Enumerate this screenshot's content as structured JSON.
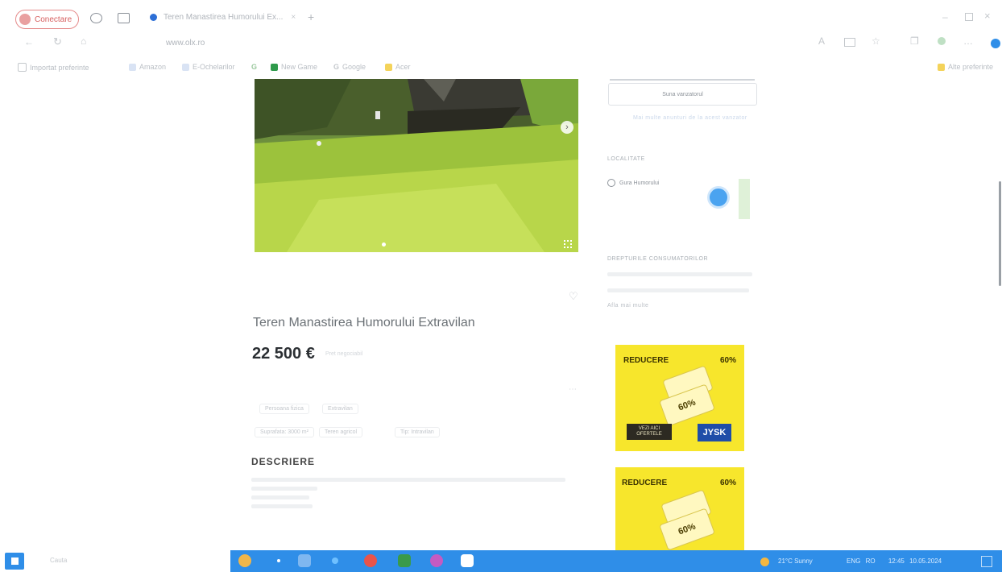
{
  "browser": {
    "signin_label": "Conectare",
    "tab_title": "Teren Manastirea Humorului Ex...",
    "url": "www.olx.ro",
    "bookmarks": [
      "Importat preferinte",
      "Amazon",
      "E-Ochelarilor",
      "New Game",
      "Google",
      "Acer"
    ],
    "other_favorites": "Alte preferinte"
  },
  "listing": {
    "title": "Teren Manastirea Humorului Extravilan",
    "price": "22 500 €",
    "price_note": "Pret negociabil",
    "tags": [
      "Persoana fizica",
      "Extravilan",
      "Suprafata: 3000 m²",
      "Teren agricol",
      "Tip: Intravilan"
    ],
    "description_heading": "DESCRIERE"
  },
  "sidebar": {
    "category_button": "Suna vanzatorul",
    "seller_link": "Mai multe anunturi de la acest vanzator",
    "location_heading": "LOCALITATE",
    "location_value": "Gura Humorului",
    "consumer_heading": "DREPTURILE CONSUMATORILOR",
    "see_more": "Afla mai multe"
  },
  "ads": [
    {
      "label": "REDUCERE",
      "percent": "60%",
      "brand": "JYSK",
      "button": "VEZI AICI OFERTELE"
    },
    {
      "label": "REDUCERE",
      "percent": "60%"
    }
  ],
  "taskbar": {
    "search_placeholder": "Cauta",
    "weather": "21°C  Sunny",
    "lang": "ENG",
    "region": "RO",
    "time": "12:45",
    "date": "10.05.2024"
  },
  "colors": {
    "taskbar_blue": "#2f8ee8",
    "ad_yellow": "#f7e62c",
    "price_text": "#2b2f33"
  },
  "icons": [
    "profile-icon",
    "collections-icon",
    "tab-actions-icon",
    "back-icon",
    "refresh-icon",
    "home-icon",
    "favorite-icon",
    "next-photo-icon",
    "location-pin-icon",
    "heart-icon",
    "windows-icon",
    "weather-icon"
  ]
}
